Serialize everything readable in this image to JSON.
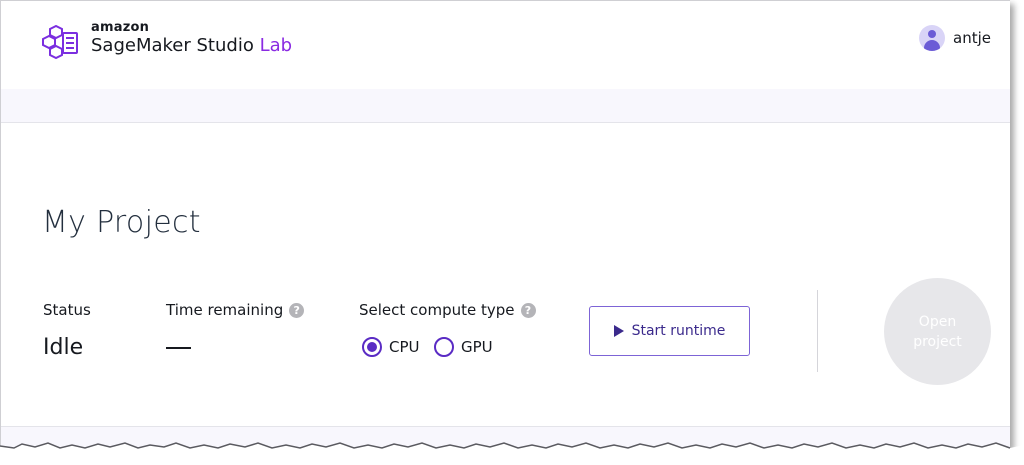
{
  "header": {
    "logo_amazon": "amazon",
    "logo_product": "SageMaker Studio ",
    "logo_lab": "Lab",
    "username": "antje",
    "brand_color": "#8a2be2"
  },
  "project": {
    "title": "My Project",
    "status_label": "Status",
    "status_value": "Idle",
    "time_label": "Time remaining",
    "time_value": "—",
    "compute_label": "Select compute type",
    "compute_options": [
      "CPU",
      "GPU"
    ],
    "compute_selected": "CPU",
    "start_label": "Start runtime",
    "open_label": "Open project"
  },
  "icons": {
    "help": "help-circle-icon",
    "play": "play-icon",
    "avatar": "user-avatar-icon",
    "logo": "sagemaker-logo-icon"
  },
  "colors": {
    "accent": "#5a2bc4",
    "button_text": "#3b2a8c",
    "disabled_circle": "#e7e7ea"
  }
}
